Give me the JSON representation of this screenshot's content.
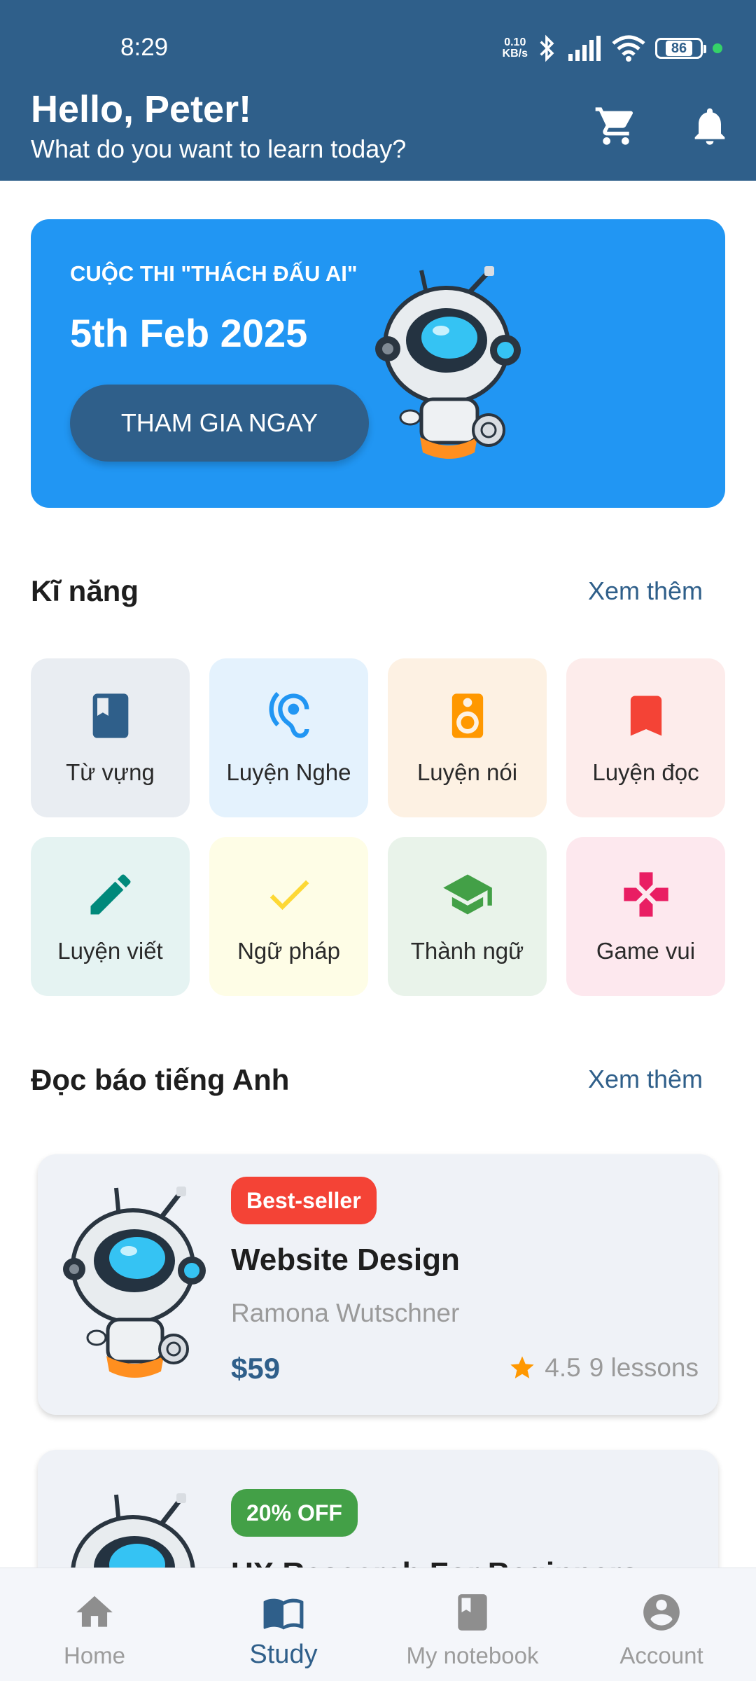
{
  "status_bar": {
    "time": "8:29",
    "net_speed_value": "0.10",
    "net_speed_unit": "KB/s",
    "battery": "86"
  },
  "header": {
    "greeting": "Hello, Peter!",
    "subtitle": "What do you want to learn today?",
    "icons": [
      "cart-icon",
      "bell-icon"
    ],
    "background_color": "#2f5f8a"
  },
  "banner": {
    "subtitle": "CUỘC THI \"THÁCH ĐẤU AI\"",
    "date": "5th Feb 2025",
    "button_label": "THAM GIA NGAY",
    "background_color": "#2196f3"
  },
  "skills": {
    "title": "Kĩ năng",
    "more_label": "Xem thêm",
    "items": [
      {
        "label": "Từ vựng",
        "icon": "book-icon",
        "color": "#2f5f8a",
        "bg": "#e9edf2"
      },
      {
        "label": "Luyện Nghe",
        "icon": "ear-icon",
        "color": "#2196f3",
        "bg": "#e4f2fd"
      },
      {
        "label": "Luyện nói",
        "icon": "speaker-icon",
        "color": "#ff9800",
        "bg": "#fdf1e3"
      },
      {
        "label": "Luyện đọc",
        "icon": "bookmark-icon",
        "color": "#f44336",
        "bg": "#fdeceb"
      },
      {
        "label": "Luyện viết",
        "icon": "pencil-icon",
        "color": "#00897b",
        "bg": "#e5f3f2"
      },
      {
        "label": "Ngữ pháp",
        "icon": "check-icon",
        "color": "#fdd835",
        "bg": "#fefde6"
      },
      {
        "label": "Thành ngữ",
        "icon": "graduation-cap-icon",
        "color": "#43a047",
        "bg": "#e9f3ea"
      },
      {
        "label": "Game vui",
        "icon": "gamepad-icon",
        "color": "#e91e63",
        "bg": "#fde8ee"
      }
    ]
  },
  "news": {
    "title": "Đọc báo tiếng Anh",
    "more_label": "Xem thêm"
  },
  "courses": [
    {
      "badge": "Best-seller",
      "badge_color": "#f44336",
      "title": "Website Design",
      "author": "Ramona Wutschner",
      "price": "$59",
      "rating": "4.5",
      "lessons": "9 lessons"
    },
    {
      "badge": "20% OFF",
      "badge_color": "#43a047",
      "title": "UX Research For Beginners"
    }
  ],
  "bottom_nav": {
    "items": [
      {
        "label": "Home",
        "icon": "home-icon",
        "active": false
      },
      {
        "label": "Study",
        "icon": "open-book-icon",
        "active": true
      },
      {
        "label": "My notebook",
        "icon": "notebook-icon",
        "active": false
      },
      {
        "label": "Account",
        "icon": "account-circle-icon",
        "active": false
      }
    ],
    "active_color": "#2f5f8a"
  }
}
